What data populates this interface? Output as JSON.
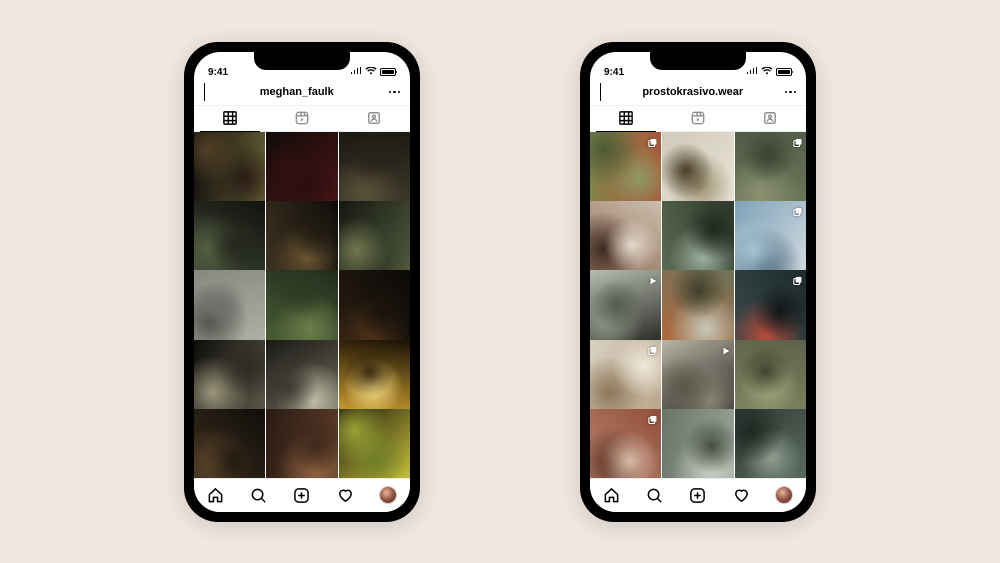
{
  "status": {
    "time": "9:41"
  },
  "phones": [
    {
      "username": "meghan_faulk",
      "tabs": {
        "active_index": 0
      },
      "posts": [
        {
          "indicator": null,
          "colors": [
            "#0e0d0b",
            "#686035",
            "#2a1d16",
            "#514026"
          ],
          "name": "dark-floral-still-life"
        },
        {
          "indicator": null,
          "colors": [
            "#120b0a",
            "#4a1517",
            "#2a0e0d",
            "#30110f"
          ],
          "name": "red-drapery-dark"
        },
        {
          "indicator": null,
          "colors": [
            "#1b1812",
            "#3e382a",
            "#5a5237",
            "#272219"
          ],
          "name": "dim-portrait"
        },
        {
          "indicator": null,
          "colors": [
            "#11120e",
            "#3d4534",
            "#565e40",
            "#24281c"
          ],
          "name": "arched-window-garden-1"
        },
        {
          "indicator": null,
          "colors": [
            "#0c0b09",
            "#3f3322",
            "#6a5530",
            "#201a11"
          ],
          "name": "dark-bouquet"
        },
        {
          "indicator": null,
          "colors": [
            "#141711",
            "#525b3e",
            "#2d3322",
            "#6e764f"
          ],
          "name": "wrought-iron-garden"
        },
        {
          "indicator": null,
          "colors": [
            "#87887f",
            "#aeb0a7",
            "#4e5249",
            "#6e726a"
          ],
          "name": "overcast-sky-ledge"
        },
        {
          "indicator": null,
          "colors": [
            "#1f2d1d",
            "#4a5f35",
            "#6d7e4a",
            "#2c3b22"
          ],
          "name": "hedge-garden"
        },
        {
          "indicator": null,
          "colors": [
            "#0a0907",
            "#2a1d12",
            "#4a3218",
            "#1a120b"
          ],
          "name": "candlelit-interior"
        },
        {
          "indicator": null,
          "colors": [
            "#0e0d0b",
            "#5a5748",
            "#9a9579",
            "#2c2a22"
          ],
          "name": "stone-archway-light"
        },
        {
          "indicator": null,
          "colors": [
            "#1a1916",
            "#6e6b5a",
            "#c2bfa9",
            "#3a372e"
          ],
          "name": "river-bridge-sepia"
        },
        {
          "indicator": null,
          "colors": [
            "#1a1206",
            "#c99a2e",
            "#fbe38a",
            "#3a2a0e"
          ],
          "name": "golden-sunset-skyline"
        },
        {
          "indicator": null,
          "colors": [
            "#0f0d0a",
            "#3d2f1e",
            "#5e492b",
            "#221a10"
          ],
          "name": "dim-window-interior"
        },
        {
          "indicator": null,
          "colors": [
            "#2a1b14",
            "#5c3c28",
            "#8f6240",
            "#3e291c"
          ],
          "name": "antique-hall-figure"
        },
        {
          "indicator": null,
          "colors": [
            "#1e1a0e",
            "#c9c23a",
            "#6f7f2a",
            "#9aa334"
          ],
          "name": "yellow-flowers-vase"
        }
      ]
    },
    {
      "username": "prostokrasivo.wear",
      "tabs": {
        "active_index": 0
      },
      "posts": [
        {
          "indicator": "multi",
          "colors": [
            "#7a8a4e",
            "#b05038",
            "#8e9a60",
            "#4e5a34"
          ],
          "name": "green-hills-red-dress"
        },
        {
          "indicator": null,
          "colors": [
            "#cfcaba",
            "#e8e3d3",
            "#9a8e70",
            "#4a3e28"
          ],
          "name": "yellow-scarf-portrait"
        },
        {
          "indicator": "multi",
          "colors": [
            "#515a46",
            "#6f7758",
            "#8b9272",
            "#3a4232"
          ],
          "name": "olive-dress-pose"
        },
        {
          "indicator": null,
          "colors": [
            "#cdbfae",
            "#8f6b56",
            "#3d2b22",
            "#e3d8cb"
          ],
          "name": "brunette-closeup"
        },
        {
          "indicator": null,
          "colors": [
            "#2e3a2c",
            "#5a6a52",
            "#9fb0a0",
            "#1e281c"
          ],
          "name": "mountain-valley-figure"
        },
        {
          "indicator": "multi",
          "colors": [
            "#7ea2b8",
            "#cfd9df",
            "#3f5a6b",
            "#a7c3d2"
          ],
          "name": "glacier-ring"
        },
        {
          "indicator": "play",
          "colors": [
            "#b6bdb0",
            "#2a2a26",
            "#8d9486",
            "#545a4c"
          ],
          "name": "dark-dress-studio"
        },
        {
          "indicator": null,
          "colors": [
            "#6e7258",
            "#b16a3e",
            "#c7c9ba",
            "#3e402e"
          ],
          "name": "redhead-field"
        },
        {
          "indicator": "multi",
          "colors": [
            "#1e2a2c",
            "#3a4a4c",
            "#b84a3a",
            "#0e1618"
          ],
          "name": "red-dress-piano-dark"
        },
        {
          "indicator": "multi",
          "colors": [
            "#d8d0bf",
            "#b8a78e",
            "#8c7558",
            "#efe8d9"
          ],
          "name": "dancer-beige"
        },
        {
          "indicator": "play",
          "colors": [
            "#b9b6a6",
            "#2a2823",
            "#8a8576",
            "#5a564a"
          ],
          "name": "black-blouse-portrait"
        },
        {
          "indicator": null,
          "colors": [
            "#5e624a",
            "#7f835e",
            "#a4a882",
            "#40442e"
          ],
          "name": "olive-dresses-duo"
        },
        {
          "indicator": "multi",
          "colors": [
            "#914e3a",
            "#b8866f",
            "#5a2f22",
            "#d9bba9"
          ],
          "name": "terracotta-portrait"
        },
        {
          "indicator": null,
          "colors": [
            "#6a7468",
            "#9aa498",
            "#c7cfc3",
            "#454e43"
          ],
          "name": "riverbed-figure"
        },
        {
          "indicator": null,
          "colors": [
            "#2e3a34",
            "#5a6a5e",
            "#8f9e90",
            "#1e2822"
          ],
          "name": "hooded-forest-portrait"
        }
      ]
    }
  ],
  "icons": {
    "grid": "grid-icon",
    "reels": "reels-icon",
    "tagged": "tagged-icon",
    "home": "home-icon",
    "search": "search-icon",
    "add": "plus-square-icon",
    "activity": "heart-icon",
    "profile": "avatar-icon",
    "multi": "carousel-icon",
    "play": "play-icon"
  }
}
